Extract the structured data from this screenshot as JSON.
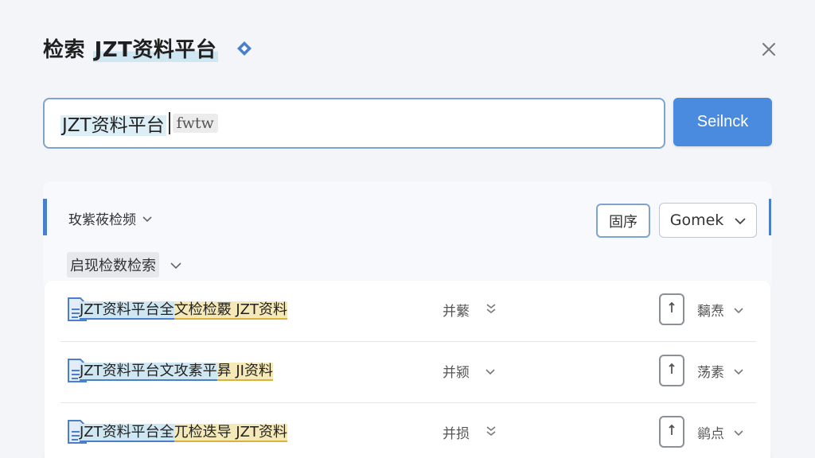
{
  "header": {
    "title_prefix": "检索",
    "title_main": "JZT资料平台"
  },
  "search": {
    "query": "JZT资料平台",
    "ime_hint": "fwtw",
    "button_label": "Seilnck"
  },
  "filters": {
    "type_label": "玫紫莜检频",
    "order_label": "固序",
    "engine_value": "Gomek",
    "sub_label": "启现检数检索"
  },
  "results": [
    {
      "title_blue": "JZT资料平台全",
      "title_yellow": "文检检覈 JZT资料",
      "status": "并蘩",
      "tag": "黐焘"
    },
    {
      "title_blue": "JZT资料平台文攻素平",
      "title_yellow": "昪 JI资料",
      "status": "并颍",
      "tag": "荡素"
    },
    {
      "title_blue": "JZT资料平台全",
      "title_yellow": "兀检迭导 JZT资料",
      "status": "并损",
      "tag": "鹟点"
    }
  ],
  "colors": {
    "accent": "#4a8be0",
    "border_blue": "#7fa3cf",
    "highlight_blue": "#cfe7f2",
    "highlight_yellow": "#f6e9b8"
  }
}
